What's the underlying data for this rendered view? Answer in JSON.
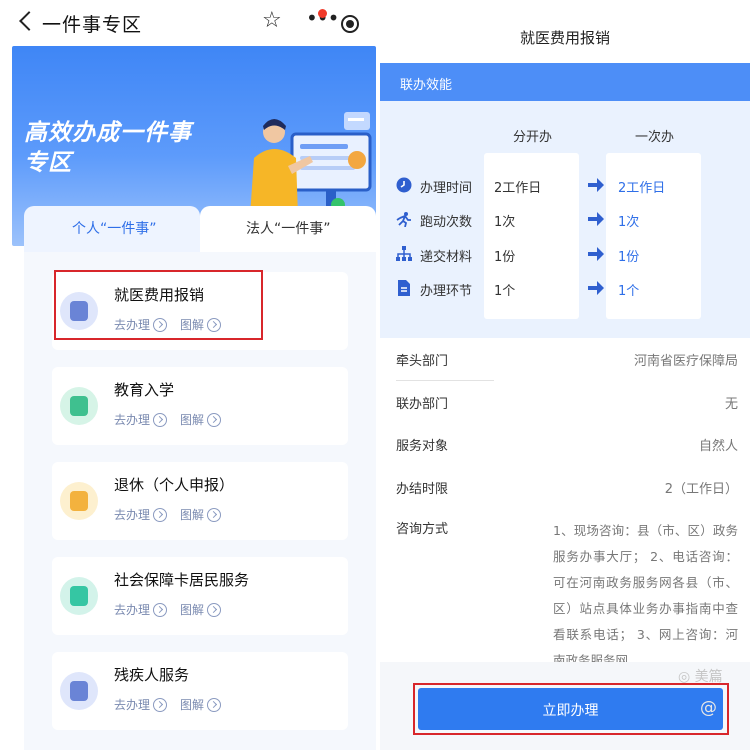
{
  "left": {
    "header": {
      "title": "一件事专区"
    },
    "banner": {
      "title_line1": "高效办成一件事",
      "title_line2": "专区"
    },
    "tabs": [
      {
        "label": "个人“一件事”",
        "active": true
      },
      {
        "label": "法人“一件事”",
        "active": false
      }
    ],
    "items": [
      {
        "title": "就医费用报销",
        "action": "去办理",
        "guide": "图解",
        "color": "#6a84d6",
        "icon": "medical-icon"
      },
      {
        "title": "教育入学",
        "action": "去办理",
        "guide": "图解",
        "color": "#3fc08f",
        "icon": "education-icon"
      },
      {
        "title": "退休（个人申报）",
        "action": "去办理",
        "guide": "图解",
        "color": "#f3b23e",
        "icon": "retirement-icon"
      },
      {
        "title": "社会保障卡居民服务",
        "action": "去办理",
        "guide": "图解",
        "color": "#35c6a3",
        "icon": "social-card-icon"
      },
      {
        "title": "残疾人服务",
        "action": "去办理",
        "guide": "图解",
        "color": "#6a84d6",
        "icon": "disability-icon"
      }
    ]
  },
  "right": {
    "title": "就医费用报销",
    "section_title": "联办效能",
    "compare": {
      "col_separate": "分开办",
      "col_once": "一次办",
      "rows": [
        {
          "label": "办理时间",
          "separate": "2工作日",
          "once": "2工作日",
          "icon": "clock-icon"
        },
        {
          "label": "跑动次数",
          "separate": "1次",
          "once": "1次",
          "icon": "running-icon"
        },
        {
          "label": "递交材料",
          "separate": "1份",
          "once": "1份",
          "icon": "org-chart-icon"
        },
        {
          "label": "办理环节",
          "separate": "1个",
          "once": "1个",
          "icon": "document-icon"
        }
      ]
    },
    "info": [
      {
        "label": "牵头部门",
        "value": "河南省医疗保障局"
      },
      {
        "label": "联办部门",
        "value": "无"
      },
      {
        "label": "服务对象",
        "value": "自然人"
      },
      {
        "label": "办结时限",
        "value": "2（工作日）"
      }
    ],
    "consult": {
      "label": "咨询方式",
      "value": "1、现场咨询：县（市、区）政务服务办事大厅； 2、电话咨询：可在河南政务服务网各县（市、区）站点具体业务办事指南中查看联系电话； 3、网上咨询：河南政务服务网。"
    },
    "button": {
      "label": "立即办理"
    }
  },
  "colors": {
    "primary": "#2f7bf0",
    "header_blue": "#4d8ef7",
    "highlight_red": "#d8262b",
    "active_tab_text": "#2f6fe8"
  }
}
